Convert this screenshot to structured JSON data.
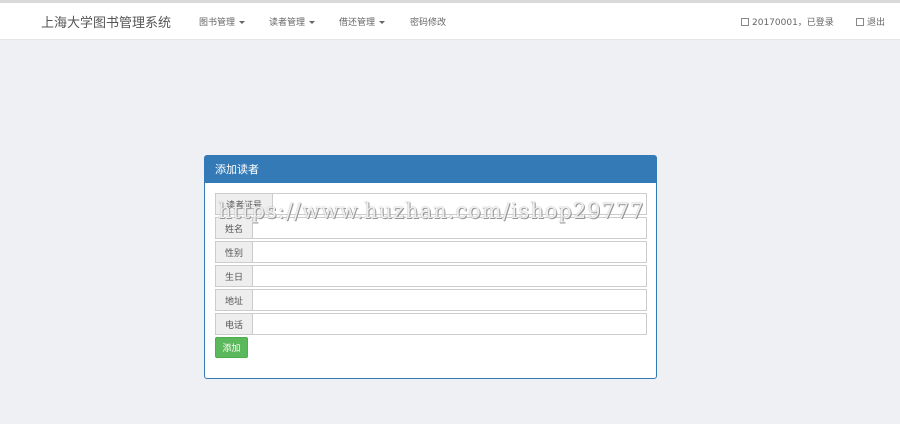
{
  "navbar": {
    "brand": "上海大学图书管理系统",
    "menu": [
      "图书管理",
      "读者管理",
      "借还管理",
      "密码修改"
    ],
    "user_status": "20170001，已登录",
    "logout": "退出"
  },
  "panel": {
    "title": "添加读者",
    "fields": [
      {
        "label": "读者证号",
        "value": ""
      },
      {
        "label": "姓名",
        "value": ""
      },
      {
        "label": "性别",
        "value": ""
      },
      {
        "label": "生日",
        "value": ""
      },
      {
        "label": "地址",
        "value": ""
      },
      {
        "label": "电话",
        "value": ""
      }
    ],
    "submit": "添加"
  },
  "watermark": "https://www.huzhan.com/ishop29777"
}
